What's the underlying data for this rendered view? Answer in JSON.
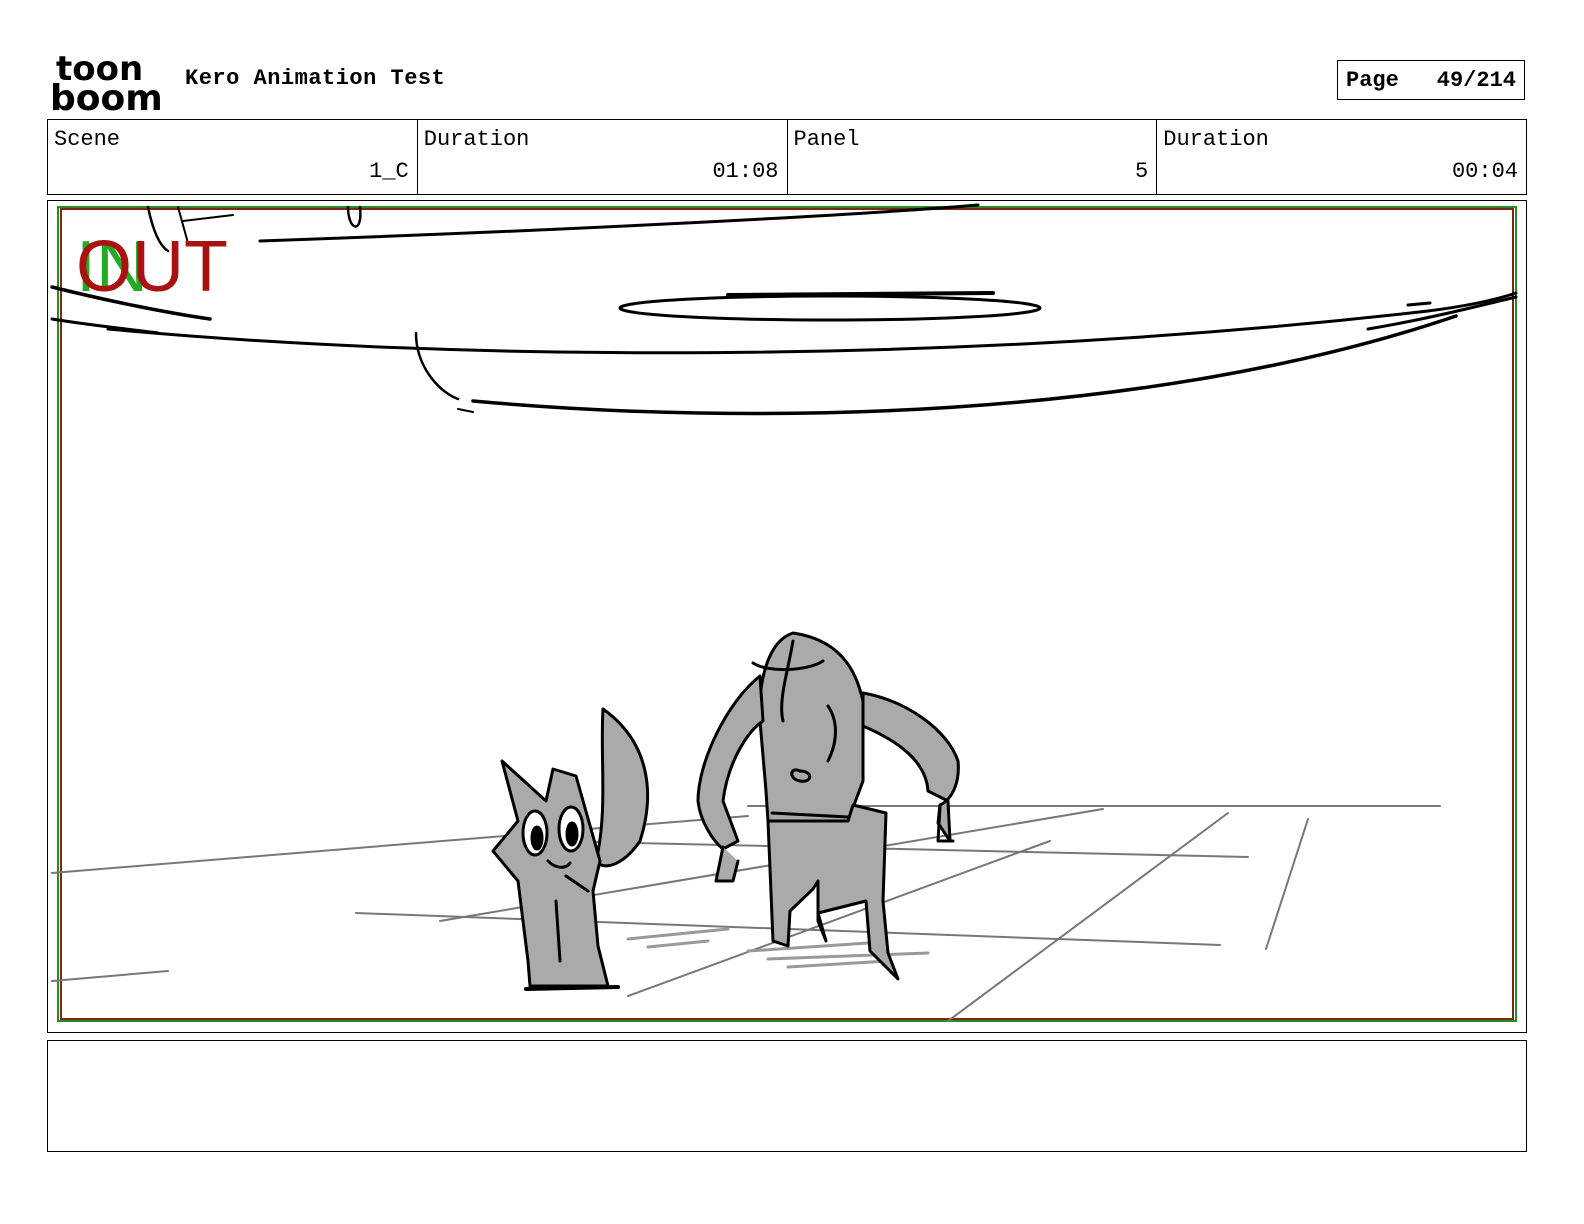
{
  "header": {
    "logo": {
      "icon": "toon-boom-logo",
      "line1": "toon",
      "line2": "boom"
    },
    "project_title": "Kero Animation Test",
    "page_label": "Page",
    "page_number": "49/214"
  },
  "info": [
    {
      "label": "Scene",
      "value": "1_C"
    },
    {
      "label": "Duration",
      "value": "01:08"
    },
    {
      "label": "Panel",
      "value": "5"
    },
    {
      "label": "Duration",
      "value": "00:04"
    }
  ],
  "panel": {
    "in_marker": "IN",
    "out_marker": "OUT",
    "colors": {
      "in": "#22aa22",
      "out": "#aa1111",
      "frame": "#7a3a1a"
    }
  },
  "notes": ""
}
